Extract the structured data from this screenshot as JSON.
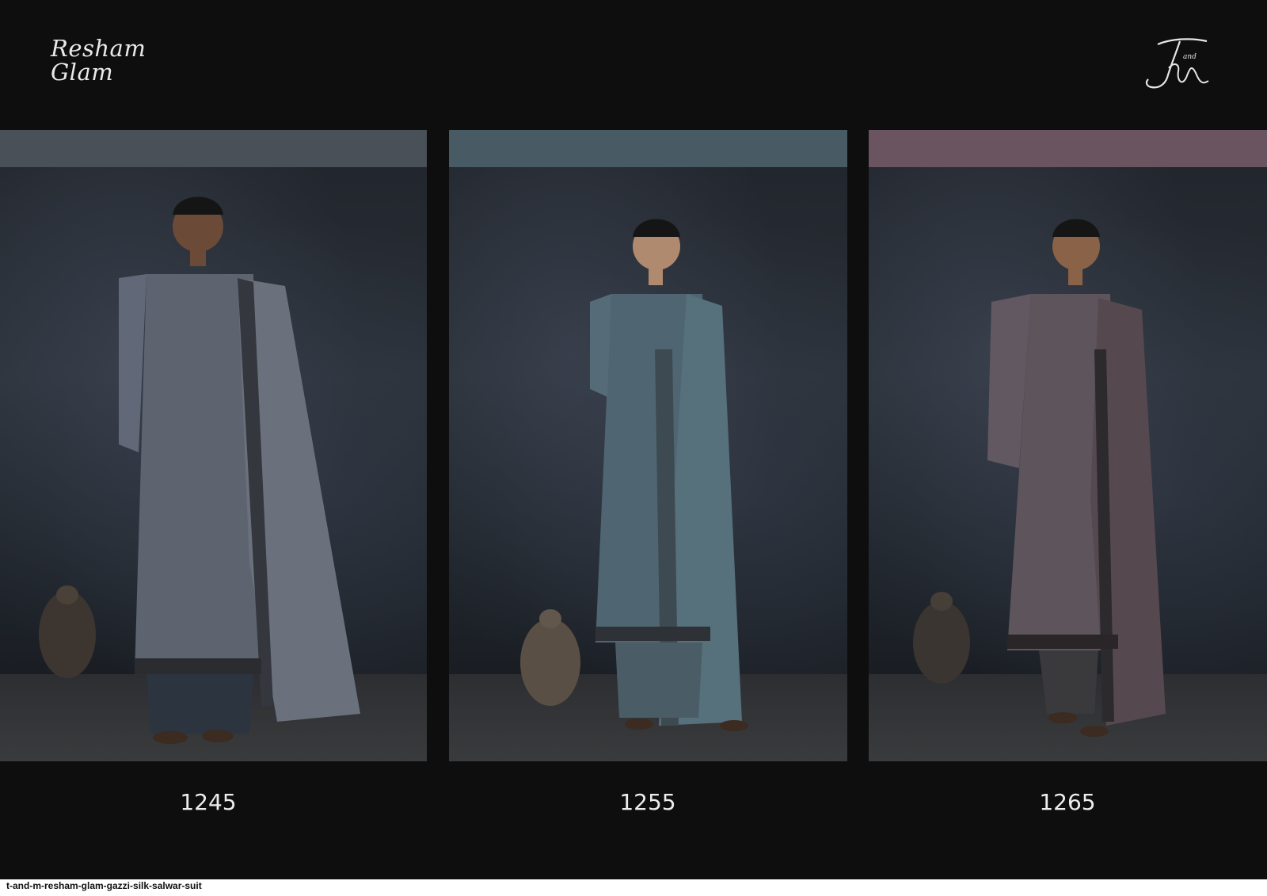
{
  "brand": {
    "line1": "Resham",
    "line2": "Glam"
  },
  "logo": {
    "icon": "tm-monogram-icon",
    "letters": "T and M"
  },
  "products": [
    {
      "code": "1245",
      "band_color": "#4a5058",
      "outfit_color": "#5d6470"
    },
    {
      "code": "1255",
      "band_color": "#485a64",
      "outfit_color": "#4f6672"
    },
    {
      "code": "1265",
      "band_color": "#6a5460",
      "outfit_color": "#5e545c"
    }
  ],
  "footer": {
    "slug": "t-and-m-resham-glam-gazzi-silk-salwar-suit"
  }
}
